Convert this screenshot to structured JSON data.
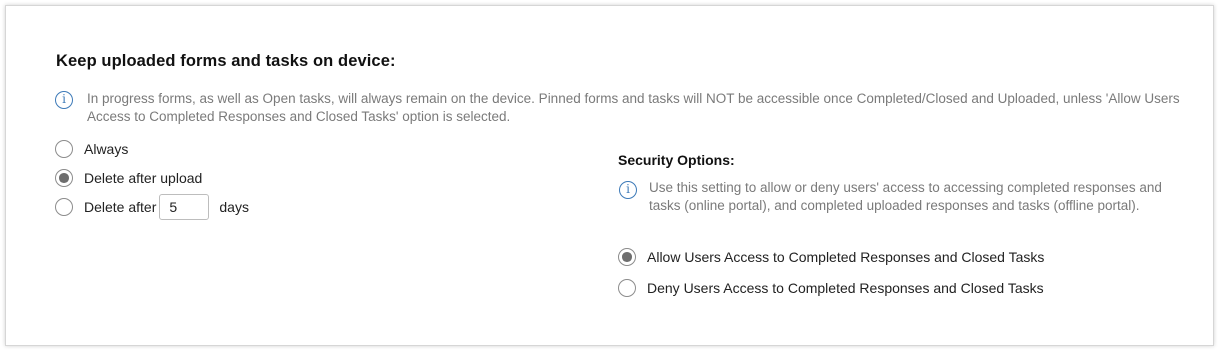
{
  "keep": {
    "title": "Keep uploaded forms and tasks on device:",
    "info": "In progress forms, as well as Open tasks, will always remain on the device. Pinned forms and tasks will NOT be accessible once Completed/Closed and Uploaded, unless 'Allow Users Access to Completed Responses and Closed Tasks' option is selected.",
    "options": [
      {
        "label": "Always",
        "checked": false
      },
      {
        "label": "Delete after upload",
        "checked": true
      },
      {
        "label": "Delete after",
        "checked": false
      }
    ],
    "days_value": "5",
    "days_unit": "days"
  },
  "security": {
    "title": "Security Options:",
    "info": "Use this setting to allow or deny users' access to accessing completed responses and tasks (online portal), and completed uploaded responses and tasks (offline portal).",
    "options": [
      {
        "label": "Allow Users Access to Completed Responses and Closed Tasks",
        "checked": true
      },
      {
        "label": "Deny Users Access to Completed Responses and Closed Tasks",
        "checked": false
      }
    ]
  },
  "colors": {
    "info_icon": "#3d7ab8",
    "info_text": "#7a7a7a",
    "radio_checked_fill": "#6e6e6e",
    "panel_border": "#d6d6d6"
  }
}
